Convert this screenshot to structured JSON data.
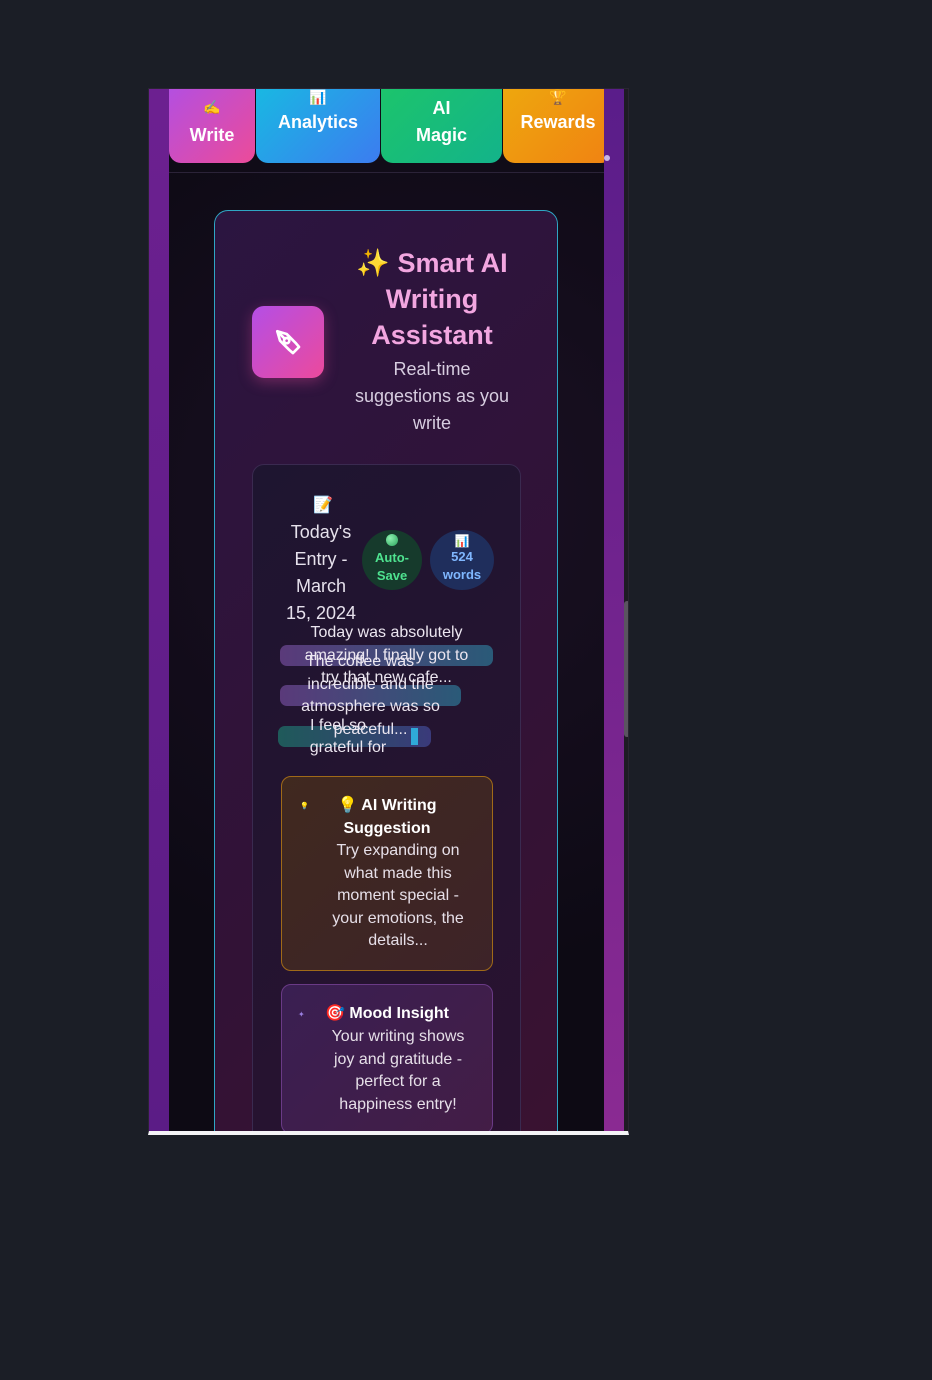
{
  "nav": {
    "tabs": [
      {
        "label": "Write",
        "icon": "✍️",
        "color": "#d04fc0"
      },
      {
        "label": "Analytics",
        "icon": "📊",
        "color": "#2a9ae8"
      },
      {
        "label_line1": "AI",
        "label_line2": "Magic",
        "icon": "🤖",
        "color": "#19bd78"
      },
      {
        "label": "Rewards",
        "icon": "🏆",
        "color": "#ef9a10"
      }
    ]
  },
  "assistant": {
    "title_line1": "✨ Smart AI",
    "title_line2": "Writing",
    "title_line3": "Assistant",
    "subtitle_line1": "Real-time",
    "subtitle_line2": "suggestions as you",
    "subtitle_line3": "write",
    "icon": "pen-tool-icon"
  },
  "entry": {
    "doc_icon": "📝",
    "date_line1": "Today's",
    "date_line2": "Entry -",
    "date_line3": "March",
    "date_line4": "15, 2024",
    "autosave_line1": "Auto-",
    "autosave_line2": "Save",
    "words_icon": "📊",
    "words_count": "524",
    "words_label": "words",
    "text_lines": [
      "Today was absolutely",
      "amazing! I finally got to",
      "try that new cafe...",
      "The coffee was",
      "incredible and the",
      "atmosphere was so",
      "peaceful...",
      "I feel so",
      "grateful for"
    ]
  },
  "suggestion": {
    "icon": "💡",
    "title_line1": "💡 AI Writing",
    "title_line2": "Suggestion",
    "body_lines": [
      "Try expanding on",
      "what made this",
      "moment special -",
      "your emotions, the",
      "details..."
    ]
  },
  "mood": {
    "title": "🎯 Mood Insight",
    "body_lines": [
      "Your writing shows",
      "joy and gratitude -",
      "perfect for a",
      "happiness entry!"
    ]
  }
}
